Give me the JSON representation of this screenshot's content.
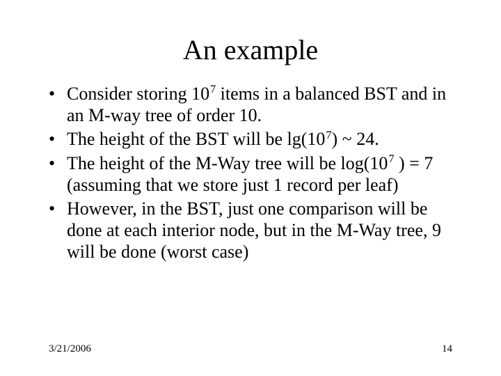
{
  "title": "An example",
  "bullets": [
    {
      "pre": "Consider storing 10",
      "sup": "7",
      "post": " items in a balanced BST and in an M-way tree of order 10."
    },
    {
      "pre": "The height of the BST will be lg(10",
      "sup": "7",
      "post": ") ~ 24."
    },
    {
      "pre": "The height of the M-Way tree will be log(10",
      "sup": "7",
      "post": " ) = 7 (assuming that we store just 1 record per leaf)"
    },
    {
      "pre": "However, in the BST, just one comparison will be done at each interior node, but in the M-Way tree, 9 will be done (worst case)",
      "sup": "",
      "post": ""
    }
  ],
  "footer": {
    "date": "3/21/2006",
    "page": "14"
  }
}
